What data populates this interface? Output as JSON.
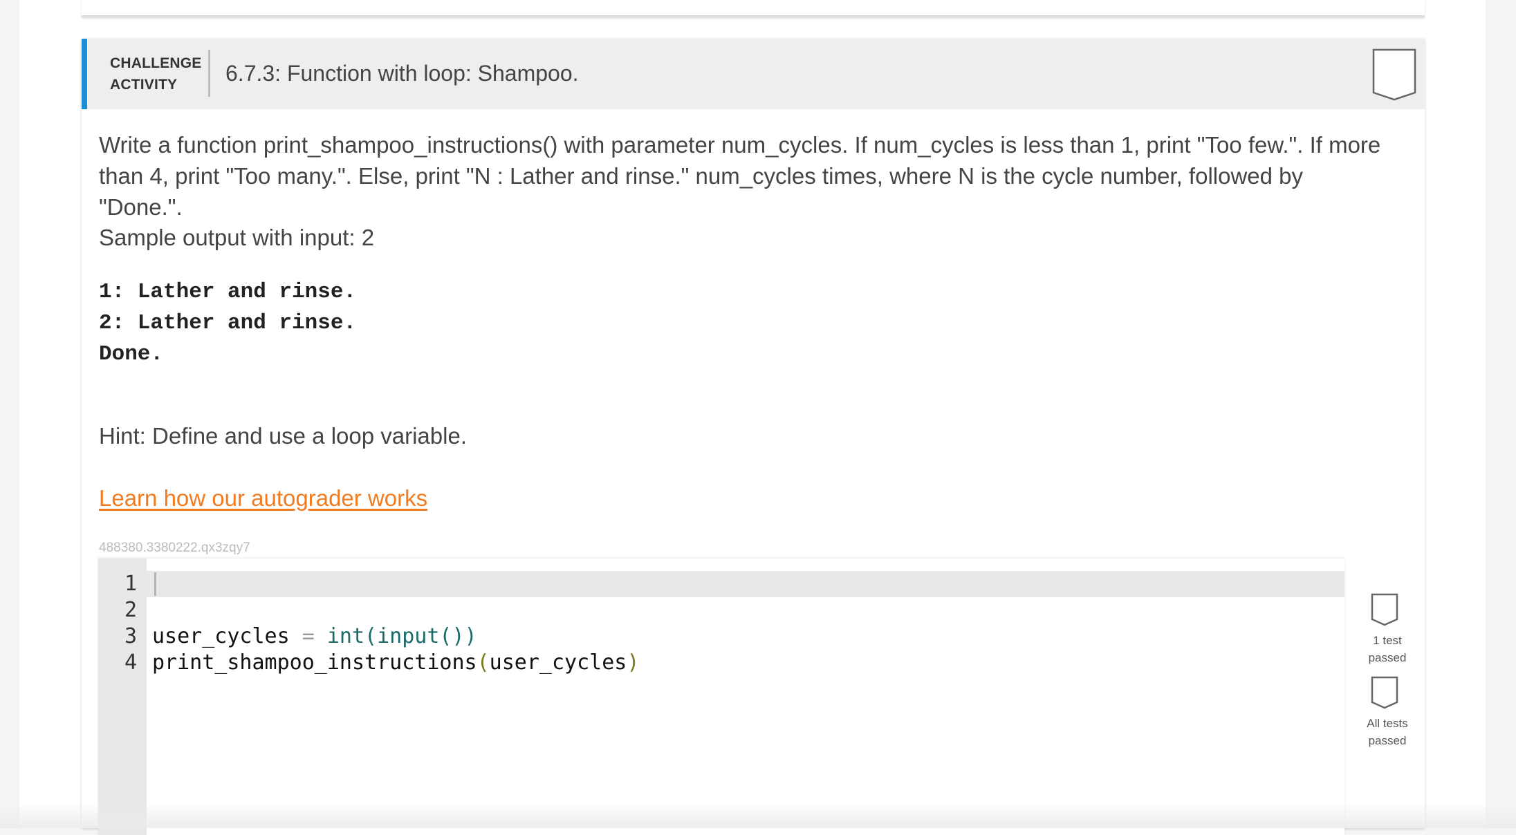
{
  "activity": {
    "type_line1": "CHALLENGE",
    "type_line2": "ACTIVITY",
    "title": "6.7.3: Function with loop: Shampoo."
  },
  "description": "Write a function print_shampoo_instructions() with parameter num_cycles. If num_cycles is less than 1, print \"Too few.\". If more than 4, print \"Too many.\". Else, print \"N : Lather and rinse.\" num_cycles times, where N is the cycle number, followed by \"Done.\".",
  "sample": {
    "heading": "Sample output with input: 2",
    "lines": [
      "1: Lather and rinse.",
      "2: Lather and rinse.",
      "Done."
    ]
  },
  "hint": "Hint: Define and use a loop variable.",
  "learn_link": "Learn how our autograder works",
  "activity_id": "488380.3380222.qx3zqy7",
  "editor": {
    "line_numbers": [
      "1",
      "2",
      "3",
      "4"
    ],
    "line3": {
      "var": "user_cycles",
      "op": " = ",
      "call": "int(input())"
    },
    "line4": {
      "func": "print_shampoo_instructions",
      "open": "(",
      "arg": "user_cycles",
      "close": ")"
    }
  },
  "tests": {
    "first_label_line1": "1 test",
    "first_label_line2": "passed",
    "second_label_line1": "All tests",
    "second_label_line2": "passed"
  }
}
